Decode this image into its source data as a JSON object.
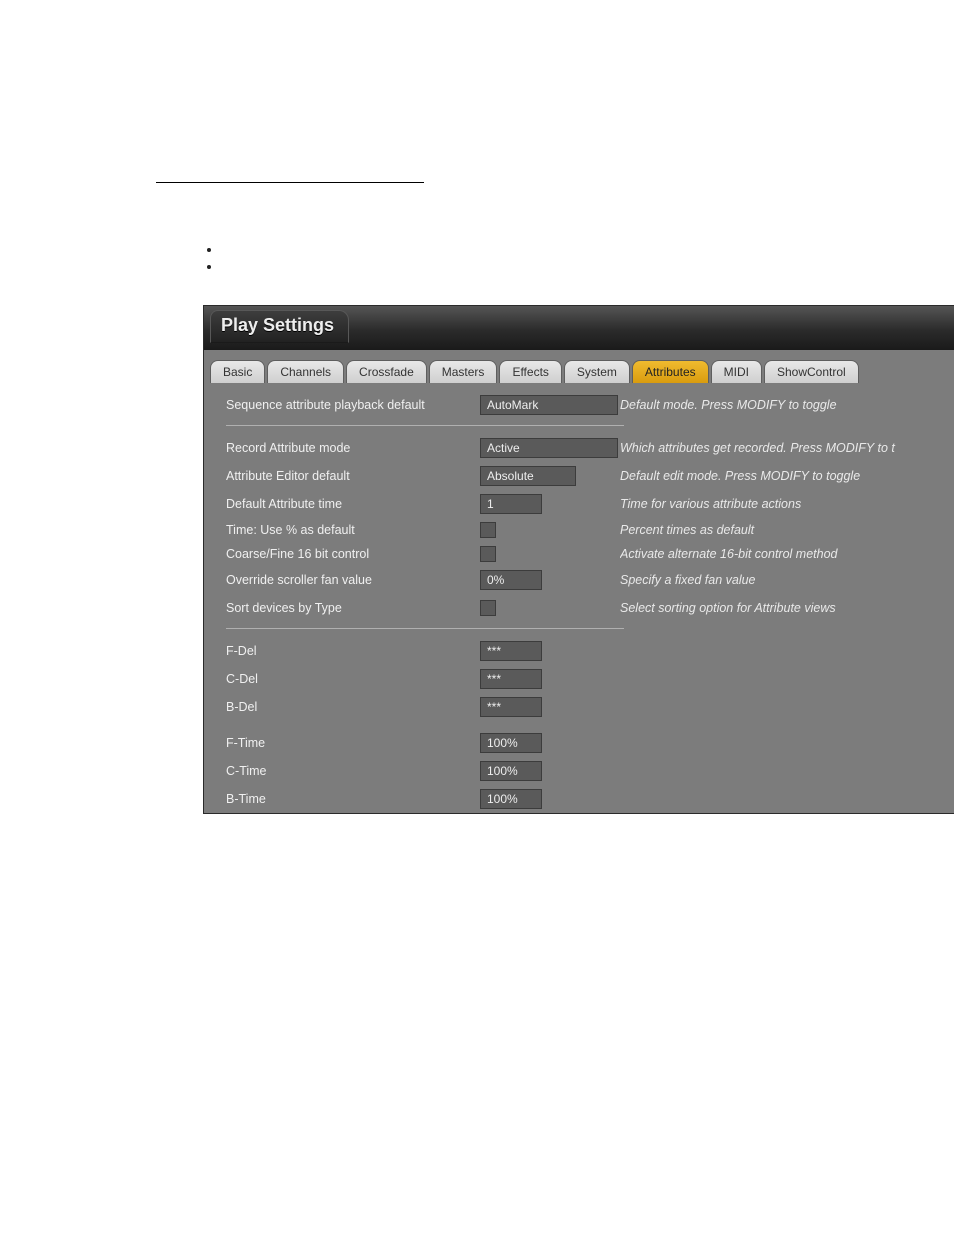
{
  "window_title": "Play Settings",
  "tabs": [
    "Basic",
    "Channels",
    "Crossfade",
    "Masters",
    "Effects",
    "System",
    "Attributes",
    "MIDI",
    "ShowControl"
  ],
  "active_tab_index": 6,
  "sec1": {
    "seq_attr": {
      "label": "Sequence attribute playback default",
      "value": "AutoMark",
      "hint": "Default mode. Press MODIFY to toggle"
    }
  },
  "sec2": {
    "record_mode": {
      "label": "Record Attribute mode",
      "value": "Active",
      "hint": "Which attributes get recorded. Press MODIFY to t"
    },
    "editor_default": {
      "label": "Attribute Editor default",
      "value": "Absolute",
      "hint": "Default edit mode. Press MODIFY to toggle"
    },
    "default_time": {
      "label": "Default Attribute time",
      "value": "1",
      "hint": "Time for various attribute actions"
    },
    "use_percent": {
      "label": "Time: Use % as default",
      "hint": "Percent times as default"
    },
    "coarse_fine": {
      "label": "Coarse/Fine 16 bit control",
      "hint": "Activate alternate 16-bit control method"
    },
    "override_fan": {
      "label": "Override scroller fan value",
      "value": "0%",
      "hint": "Specify a fixed fan value"
    },
    "sort_type": {
      "label": "Sort devices by Type",
      "hint": "Select sorting option for Attribute views"
    }
  },
  "del": {
    "f": {
      "label": "F-Del",
      "value": "***"
    },
    "c": {
      "label": "C-Del",
      "value": "***"
    },
    "b": {
      "label": "B-Del",
      "value": "***"
    }
  },
  "time": {
    "f": {
      "label": "F-Time",
      "value": "100%"
    },
    "c": {
      "label": "C-Time",
      "value": "100%"
    },
    "b": {
      "label": "B-Time",
      "value": "100%"
    }
  }
}
